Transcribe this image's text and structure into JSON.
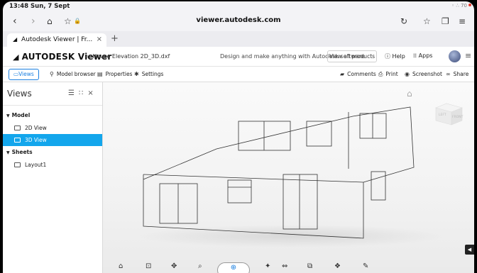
{
  "status": {
    "time": "13:48  Sun, 7 Sept",
    "right": "◦ ∴ 70"
  },
  "browser": {
    "url": "viewer.autodesk.com",
    "tab_title": "Autodesk Viewer | Fr...",
    "tab_close": "×",
    "new_tab": "+"
  },
  "app": {
    "logo": "AUTODESK Viewer",
    "breadcrumb": "House Elevation 2D_3D.dxf",
    "tagline": "Design and make anything with Autodesk software",
    "view_products": "View all products",
    "help": "Help",
    "apps": "Apps"
  },
  "toolbar": {
    "views": "Views",
    "model_browser": "Model browser",
    "properties": "Properties",
    "settings": "Settings",
    "comments": "Comments",
    "print": "Print",
    "screenshot": "Screenshot",
    "share": "Share"
  },
  "panel": {
    "title": "Views",
    "close": "×",
    "group_model": "Model",
    "item_2d": "2D View",
    "item_3d": "3D View",
    "group_sheets": "Sheets",
    "item_layout": "Layout1"
  },
  "viewcube": {
    "left": "LEFT",
    "front": "FRONT"
  },
  "colors": {
    "accent": "#13a6ec",
    "brand_blue": "#1a7fe0"
  }
}
